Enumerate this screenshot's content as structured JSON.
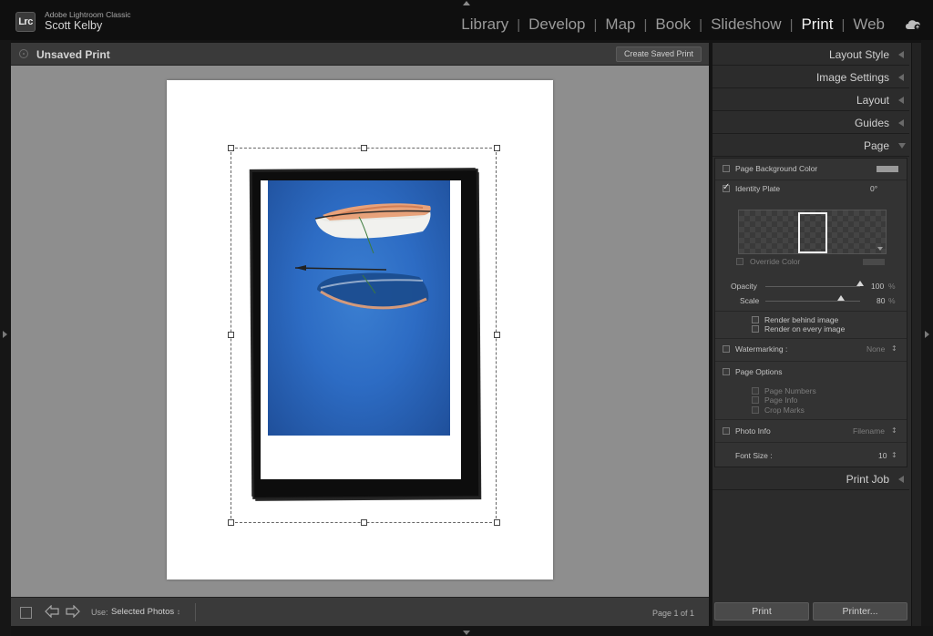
{
  "app": {
    "logo": "Lrc",
    "name": "Adobe Lightroom Classic",
    "user": "Scott Kelby"
  },
  "modules": [
    "Library",
    "Develop",
    "Map",
    "Book",
    "Slideshow",
    "Print",
    "Web"
  ],
  "active_module": "Print",
  "workspace": {
    "title": "Unsaved Print",
    "create_saved_label": "Create Saved Print"
  },
  "footer": {
    "use_label": "Use:",
    "use_value": "Selected Photos",
    "page_count": "Page 1 of 1"
  },
  "right_panel": {
    "layout_style": "Layout Style",
    "image_settings": "Image Settings",
    "layout": "Layout",
    "guides": "Guides",
    "page": "Page",
    "page_bg_color": "Page Background Color",
    "identity_plate": "Identity Plate",
    "identity_plate_angle": "0°",
    "override_color": "Override Color",
    "opacity_label": "Opacity",
    "opacity_value": "100",
    "scale_label": "Scale",
    "scale_value": "80",
    "percent": "%",
    "opacity_level": 1.0,
    "scale_level": 0.8,
    "render_behind": "Render behind image",
    "render_every": "Render on every image",
    "watermarking": "Watermarking :",
    "watermark_value": "None",
    "page_options": "Page Options",
    "page_numbers": "Page Numbers",
    "page_info": "Page Info",
    "crop_marks": "Crop Marks",
    "photo_info": "Photo Info",
    "photo_info_value": "Filename",
    "font_size_label": "Font Size :",
    "font_size_value": "10",
    "print_job": "Print Job",
    "print_button": "Print",
    "printer_button": "Printer..."
  },
  "colors": {
    "accent": "#f2f2f2",
    "panel": "#2c2c2c",
    "photo_blue": "#2d6cc4"
  }
}
